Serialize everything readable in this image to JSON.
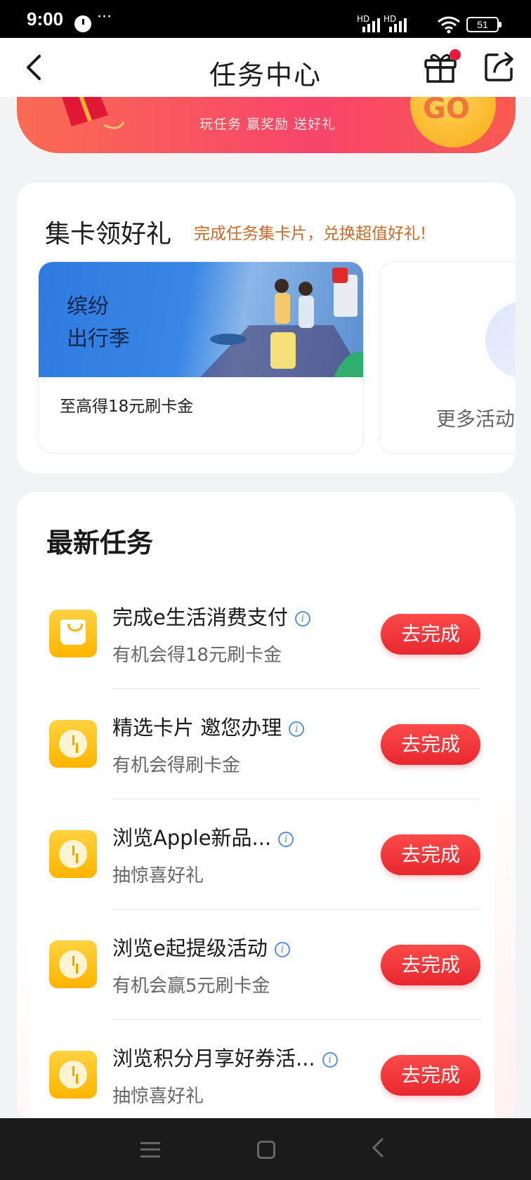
{
  "status_bar": {
    "time": "9:00",
    "more": "···",
    "network_labels": [
      "HD",
      "HD"
    ],
    "battery": "51"
  },
  "header": {
    "title": "任务中心"
  },
  "banner": {
    "subtitle": "玩任务 赢奖励 送好礼",
    "go": "GO"
  },
  "card_collection": {
    "title": "集卡领好礼",
    "slogan": "完成任务集卡片，兑换超值好礼!",
    "activity": {
      "line1": "缤纷",
      "line2": "出行季",
      "desc": "至高得18元刷卡金"
    },
    "more_label": "更多活动"
  },
  "tasks": {
    "title": "最新任务",
    "items": [
      {
        "name": "完成e生活消费支付",
        "reward": "有机会得18元刷卡金",
        "button": "去完成",
        "icon": "shopping-bag-icon"
      },
      {
        "name": "精选卡片 邀您办理",
        "reward": "有机会得刷卡金",
        "button": "去完成",
        "icon": "clock-icon"
      },
      {
        "name": "浏览Apple新品...",
        "reward": "抽惊喜好礼",
        "button": "去完成",
        "icon": "clock-icon"
      },
      {
        "name": "浏览e起提级活动",
        "reward": "有机会赢5元刷卡金",
        "button": "去完成",
        "icon": "clock-icon"
      },
      {
        "name": "浏览积分月享好券活...",
        "reward": "抽惊喜好礼",
        "button": "去完成",
        "icon": "clock-icon"
      }
    ]
  },
  "colors": {
    "accent_red": "#e8282f",
    "icon_yellow": "#ffb400",
    "slogan_orange": "#c76a2c",
    "info_blue": "#5b8de0"
  }
}
